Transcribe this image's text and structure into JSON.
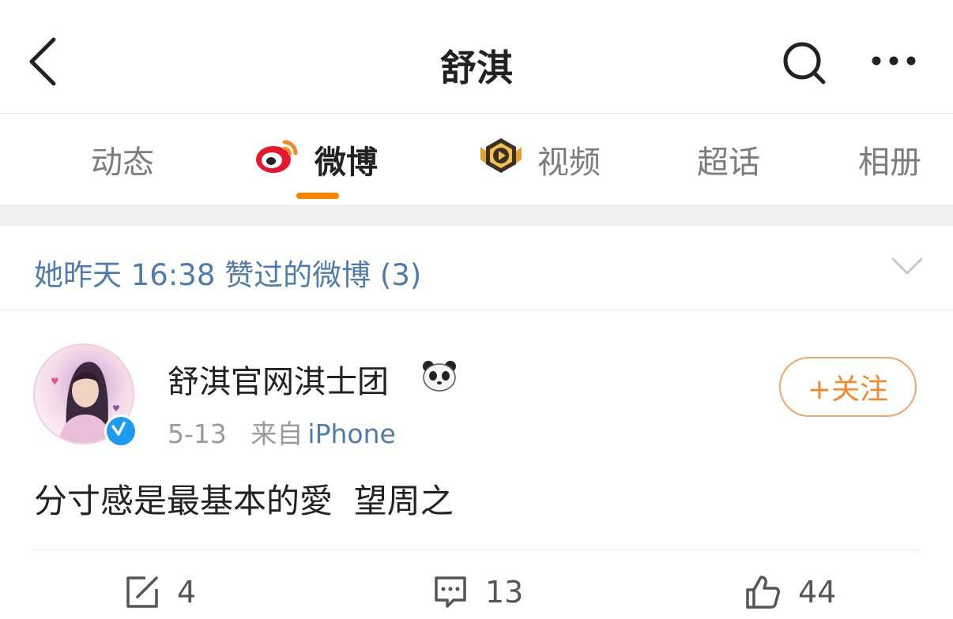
{
  "header": {
    "title": "舒淇"
  },
  "tabs": [
    {
      "label": "动态"
    },
    {
      "label": "微博",
      "active": true
    },
    {
      "label": "视频"
    },
    {
      "label": "超话"
    },
    {
      "label": "相册"
    }
  ],
  "liked_bar": {
    "text": "她昨天 16:38 赞过的微博 (3)"
  },
  "post": {
    "author": "舒淇官网淇士团",
    "date": "5-13",
    "source_prefix": "来自",
    "source": "iPhone",
    "follow_label": "+关注",
    "content": "分寸感是最基本的愛  望周之",
    "actions": {
      "repost_count": "4",
      "comment_count": "13",
      "like_count": "44"
    }
  },
  "colors": {
    "accent": "#ff8200",
    "link": "#4f7bab",
    "follow": "#f08a2c",
    "verified": "#1d9bf0"
  },
  "icons": [
    "back-arrow-icon",
    "search-icon",
    "more-icon",
    "weibo-logo-icon",
    "video-play-icon",
    "expand-chevron-icon",
    "panda-icon",
    "verified-icon",
    "repost-icon",
    "comment-icon",
    "like-icon"
  ]
}
